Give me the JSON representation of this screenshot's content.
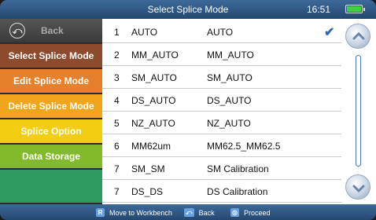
{
  "titlebar": {
    "title": "Select Splice Mode",
    "time": "16:51"
  },
  "sidebar": {
    "back_label": "Back",
    "items": [
      {
        "label": "Select Splice Mode",
        "color": "#8e4a2c"
      },
      {
        "label": "Edit Splice Mode",
        "color": "#e7802a"
      },
      {
        "label": "Delete Splice Mode",
        "color": "#f0a51c"
      },
      {
        "label": "Splice Option",
        "color": "#f3cd12"
      },
      {
        "label": "Data Storage",
        "color": "#82ba2c"
      },
      {
        "label": "",
        "color": "#2f9a60"
      }
    ]
  },
  "modes": [
    {
      "num": "1",
      "name": "AUTO",
      "mode": "AUTO",
      "selected": true
    },
    {
      "num": "2",
      "name": "MM_AUTO",
      "mode": "MM_AUTO"
    },
    {
      "num": "3",
      "name": "SM_AUTO",
      "mode": "SM_AUTO"
    },
    {
      "num": "4",
      "name": "DS_AUTO",
      "mode": "DS_AUTO"
    },
    {
      "num": "5",
      "name": "NZ_AUTO",
      "mode": "NZ_AUTO"
    },
    {
      "num": "6",
      "name": "MM62um",
      "mode": "MM62.5_MM62.5"
    },
    {
      "num": "7",
      "name": "SM_SM",
      "mode": "SM Calibration"
    },
    {
      "num": "7",
      "name": "DS_DS",
      "mode": "DS Calibration"
    }
  ],
  "check_mark": "✔",
  "bottombar": {
    "workbench_key": "R",
    "workbench_label": "Move to Workbench",
    "back_key": "⤺",
    "back_label": "Back",
    "proceed_key": "◎",
    "proceed_label": "Proceed"
  }
}
